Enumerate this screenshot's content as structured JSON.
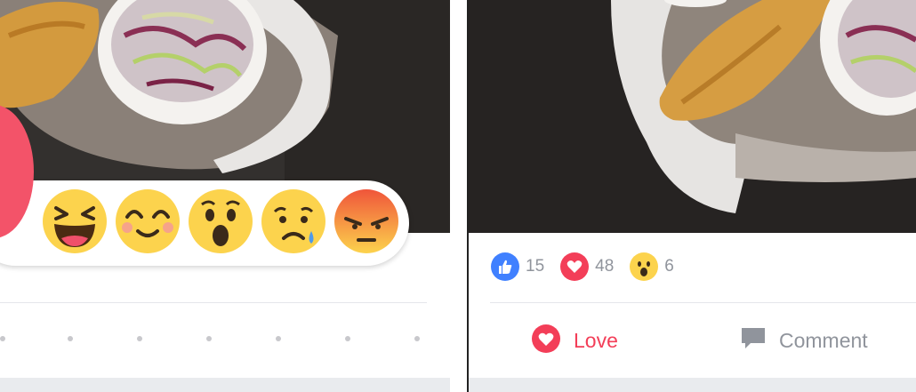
{
  "colors": {
    "love": "#f33e58",
    "like": "#4080ff",
    "muted": "#90949c",
    "emoji_yellow": "#fcd34d"
  },
  "reactions_picker": {
    "items": [
      {
        "name": "haha",
        "icon": "laughing-face-icon"
      },
      {
        "name": "yay",
        "icon": "smiling-face-icon"
      },
      {
        "name": "wow",
        "icon": "surprised-face-icon"
      },
      {
        "name": "sad",
        "icon": "crying-face-icon"
      },
      {
        "name": "angry",
        "icon": "angry-face-icon"
      }
    ]
  },
  "post": {
    "reaction_counts": [
      {
        "type": "like",
        "icon": "thumbs-up-icon",
        "count": "15"
      },
      {
        "type": "love",
        "icon": "heart-icon",
        "count": "48"
      },
      {
        "type": "wow",
        "icon": "surprised-face-icon",
        "count": "6"
      }
    ],
    "actions": {
      "love_label": "Love",
      "comment_label": "Comment"
    }
  }
}
